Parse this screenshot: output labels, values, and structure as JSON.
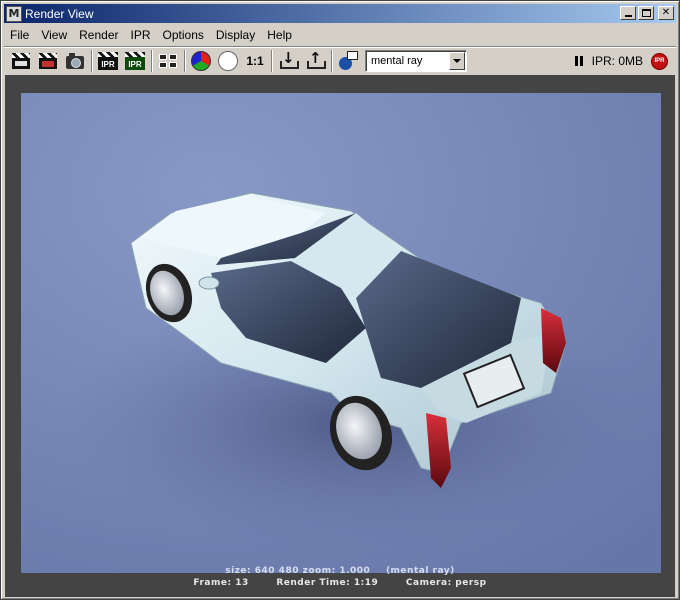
{
  "window": {
    "title": "Render View"
  },
  "menu": [
    "File",
    "View",
    "Render",
    "IPR",
    "Options",
    "Display",
    "Help"
  ],
  "toolbar": {
    "icons": [
      "redo-render-icon",
      "render-region-icon",
      "snapshot-camera-icon",
      "ipr-render-icon",
      "refresh-ipr-icon",
      "render-settings-icon",
      "rgb-channels-icon",
      "alpha-channel-icon",
      "real-size-icon",
      "keep-image-icon",
      "remove-image-icon",
      "render-snapshot-icon"
    ],
    "zoom_label": "1:1",
    "ipr_label": "IPR",
    "renderer": "mental ray",
    "ipr_memory": "IPR: 0MB",
    "ipr_stop_label": "IPR"
  },
  "render": {
    "size_text": "size:  640   480 zoom: 1.000",
    "renderer_text": "(mental ray)",
    "frame_text": "Frame: 13",
    "render_time_text": "Render Time:  1:19",
    "camera_text": "Camera: persp"
  },
  "colors": {
    "background_blue": "#7a8ab8",
    "car_body": "#dfeef4",
    "taillight": "#a01018",
    "viewport_bg": "#444444",
    "title_start": "#0a246a",
    "title_end": "#a6caf0"
  }
}
